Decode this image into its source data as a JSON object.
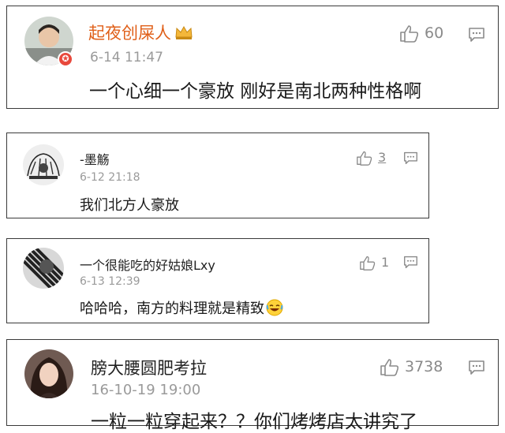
{
  "comments": [
    {
      "user": "起夜创屎人",
      "time": "6-14 11:47",
      "text": "一个心细一个豪放 刚好是南北两种性格啊",
      "likes": "60",
      "name_color": "#e0601a",
      "badge_icon": "vip-badge-icon",
      "crown_icon": "crown-icon"
    },
    {
      "user": "-墨觞",
      "time": "6-12 21:18",
      "text": "我们北方人豪放",
      "likes": "3",
      "name_color": "#222222"
    },
    {
      "user": "一个很能吃的好姑娘Lxy",
      "time": "6-13 12:39",
      "text": "哈哈哈，南方的料理就是精致",
      "likes": "1",
      "name_color": "#222222",
      "emoji_icon": "laughing-emoji-icon"
    },
    {
      "user": "膀大腰圆肥考拉",
      "time": "16-10-19 19:00",
      "text": "一粒一粒穿起来？？你们烤烤店太讲究了",
      "likes": "3738",
      "name_color": "#222222"
    }
  ],
  "icons": {
    "like": "thumbs-up-icon",
    "reply": "comment-icon"
  }
}
